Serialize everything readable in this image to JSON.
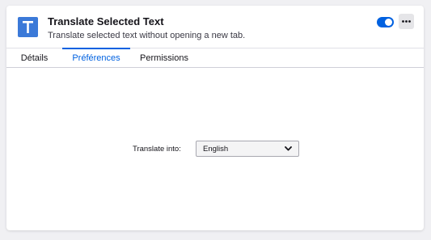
{
  "addon": {
    "icon_letter": "T",
    "icon_name": "letter-t-icon",
    "icon_color": "#3b79d8",
    "title": "Translate Selected Text",
    "description": "Translate selected text without opening a new tab.",
    "enabled": true
  },
  "header": {
    "toggle_icon": "toggle-on-icon",
    "more_icon": "more-options-icon"
  },
  "tabs": [
    {
      "label": "Détails",
      "active": false
    },
    {
      "label": "Préférences",
      "active": true
    },
    {
      "label": "Permissions",
      "active": false
    }
  ],
  "preferences": {
    "translate_into_label": "Translate into:",
    "translate_into_value": "English"
  },
  "colors": {
    "accent": "#0061e0",
    "background": "#f0f0f3",
    "card": "#ffffff"
  }
}
